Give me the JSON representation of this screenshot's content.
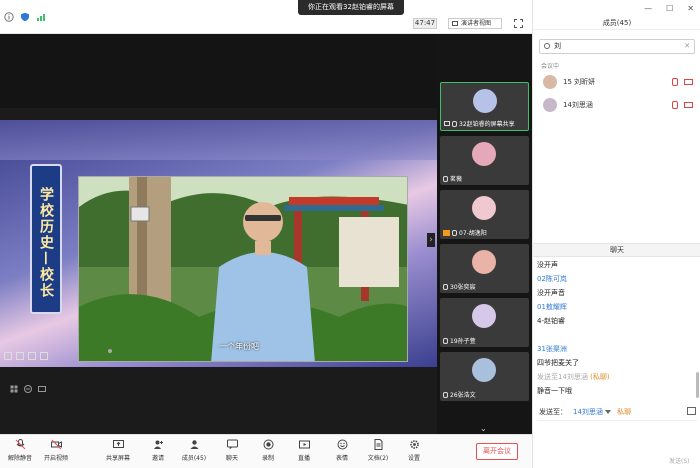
{
  "topbar": {
    "sharing_banner": "你正在观看32赵铂睿的屏幕",
    "timer": "47:47",
    "view_label": "演讲者视图"
  },
  "slide": {
    "title_vertical": "学校历史—校长",
    "subtitle": "一个年份吧"
  },
  "thumbnails": [
    {
      "name": "32赵铂睿的屏幕共享",
      "active": true
    },
    {
      "name": "茗薇",
      "active": false
    },
    {
      "name": "07-胡逸阳",
      "active": false
    },
    {
      "name": "30张奕宸",
      "active": false
    },
    {
      "name": "19孙子萱",
      "active": false
    },
    {
      "name": "26张浩文",
      "active": false
    }
  ],
  "panel": {
    "members_title": "成员(45)",
    "search_value": "刘",
    "in_meeting_label": "会议中",
    "members": [
      {
        "name": "15 刘昕妍"
      },
      {
        "name": "14刘思涵"
      }
    ],
    "chat_title": "聊天",
    "chat": [
      {
        "text": "没开声",
        "kind": "msg"
      },
      {
        "text": "02陈可岚",
        "kind": "name"
      },
      {
        "text": "没开声音",
        "kind": "msg"
      },
      {
        "text": "01敖耀辉",
        "kind": "name"
      },
      {
        "text": "4-赵铂睿",
        "kind": "msg"
      },
      {
        "text": "",
        "kind": "msg"
      },
      {
        "text": "31张渠洲",
        "kind": "name"
      },
      {
        "text": "四爷把麦关了",
        "kind": "msg"
      },
      {
        "text": "发送至14刘思涵",
        "kind": "system",
        "priv": "(私聊)"
      },
      {
        "text": "静音一下哦",
        "kind": "msg"
      }
    ],
    "send_to_label": "发送至：",
    "send_to_target": "14刘思涵",
    "private_label": "私聊",
    "send_button": "发送(S)"
  },
  "toolbar": {
    "mute": "解除静音",
    "video": "开启视频",
    "share": "共享屏幕",
    "invite": "邀请",
    "members": "成员(45)",
    "chat": "聊天",
    "record": "录制",
    "live": "直播",
    "reactions": "表情",
    "docs": "文档(2)",
    "settings": "设置",
    "leave": "离开会议"
  },
  "colors": {
    "accent_blue": "#2f78d4",
    "leave_red": "#e25050",
    "active_green": "#3fbf6a"
  }
}
